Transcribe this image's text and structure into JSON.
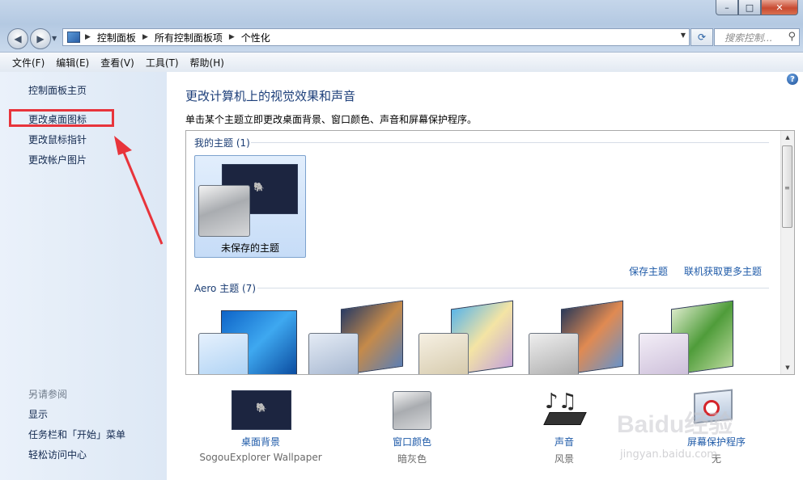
{
  "window": {
    "min_label": "–",
    "max_label": "□",
    "close_label": "✕"
  },
  "address": {
    "crumbs": [
      "控制面板",
      "所有控制面板项",
      "个性化"
    ],
    "search_placeholder": "搜索控制..."
  },
  "menu": [
    "文件(F)",
    "编辑(E)",
    "查看(V)",
    "工具(T)",
    "帮助(H)"
  ],
  "sidebar": {
    "home": "控制面板主页",
    "items": [
      "更改桌面图标",
      "更改鼠标指针",
      "更改帐户图片"
    ],
    "see_also_header": "另请参阅",
    "see_also": [
      "显示",
      "任务栏和「开始」菜单",
      "轻松访问中心"
    ]
  },
  "main": {
    "title": "更改计算机上的视觉效果和声音",
    "subtitle": "单击某个主题立即更改桌面背景、窗口颜色、声音和屏幕保护程序。",
    "my_themes_header": "我的主题 (1)",
    "unsaved_theme": "未保存的主题",
    "save_theme": "保存主题",
    "get_more": "联机获取更多主题",
    "aero_header": "Aero 主题 (7)"
  },
  "bottom": [
    {
      "label": "桌面背景",
      "value": "SogouExplorer Wallpaper"
    },
    {
      "label": "窗口颜色",
      "value": "暗灰色"
    },
    {
      "label": "声音",
      "value": "风景"
    },
    {
      "label": "屏幕保护程序",
      "value": "无"
    }
  ],
  "watermark": {
    "main": "Baidu经验",
    "sub": "jingyan.baidu.com"
  },
  "colors": {
    "accent_link": "#1e5aa8",
    "highlight_box": "#e8343b",
    "title": "#1d3f7a"
  }
}
